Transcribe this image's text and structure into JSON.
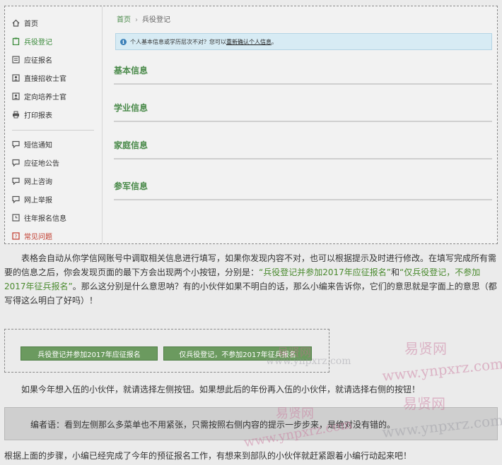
{
  "sidebar": {
    "items": [
      {
        "label": "首页",
        "icon": "home-icon"
      },
      {
        "label": "兵役登记",
        "icon": "clipboard-icon"
      },
      {
        "label": "应征报名",
        "icon": "form-icon"
      },
      {
        "label": "直接招收士官",
        "icon": "person-badge-icon"
      },
      {
        "label": "定向培养士官",
        "icon": "person-badge-icon"
      },
      {
        "label": "打印报表",
        "icon": "printer-icon"
      },
      {
        "label": "短信通知",
        "icon": "message-icon"
      },
      {
        "label": "应征地公告",
        "icon": "message-icon"
      },
      {
        "label": "网上咨询",
        "icon": "message-icon"
      },
      {
        "label": "网上举报",
        "icon": "message-icon"
      },
      {
        "label": "往年报名信息",
        "icon": "clock-icon"
      },
      {
        "label": "常见问题",
        "icon": "question-icon"
      }
    ]
  },
  "breadcrumb": {
    "home": "首页",
    "sep": "›",
    "current": "兵役登记"
  },
  "notice": {
    "text": "个人基本信息或学历层次不对？您可以",
    "link": "重新确认个人信息",
    "end": "。"
  },
  "sections": [
    "基本信息",
    "学业信息",
    "家庭信息",
    "参军信息"
  ],
  "article": {
    "p1_a": "表格会自动从你学信网账号中调取相关信息进行填写，如果你发现内容不对，也可以根据提示及时进行修改。在填写完成所有需要的信息之后，你会发现页面的最下方会出现两个小按钮，分别是：",
    "p1_q1": "“兵役登记并参加2017年应征报名”",
    "p1_and": "和",
    "p1_q2": "“仅兵役登记，不参加2017年征兵报名”",
    "p1_b": "。那么这分别是什么意思呐？有的小伙伴如果不明白的话，那么小编来告诉你，它们的意思就是字面上的意思（都写得这么明白了好吗）！",
    "btn_left": "兵役登记并参加2017年应征报名",
    "btn_right": "仅兵役登记，不参加2017年征兵报名",
    "p2": "如果今年想入伍的小伙伴，就请选择左侧按钮。如果想此后的年份再入伍的小伙伴，就请选择右侧的按钮！",
    "editor": "编者语：看到左侧那么多菜单也不用紧张，只需按照右侧内容的提示一步步来，是绝对没有错的。",
    "p3": "根据上面的步骤，小编已经完成了今年的预征报名工作，有想来到部队的小伙伴就赶紧跟着小编行动起来吧！"
  },
  "watermark": {
    "cn": "易贤网",
    "url": "www.ynpxrz.com"
  },
  "colors": {
    "green": "#4a8a4a",
    "notice_bg": "#d7ebf4",
    "button": "#6b9a5f"
  }
}
